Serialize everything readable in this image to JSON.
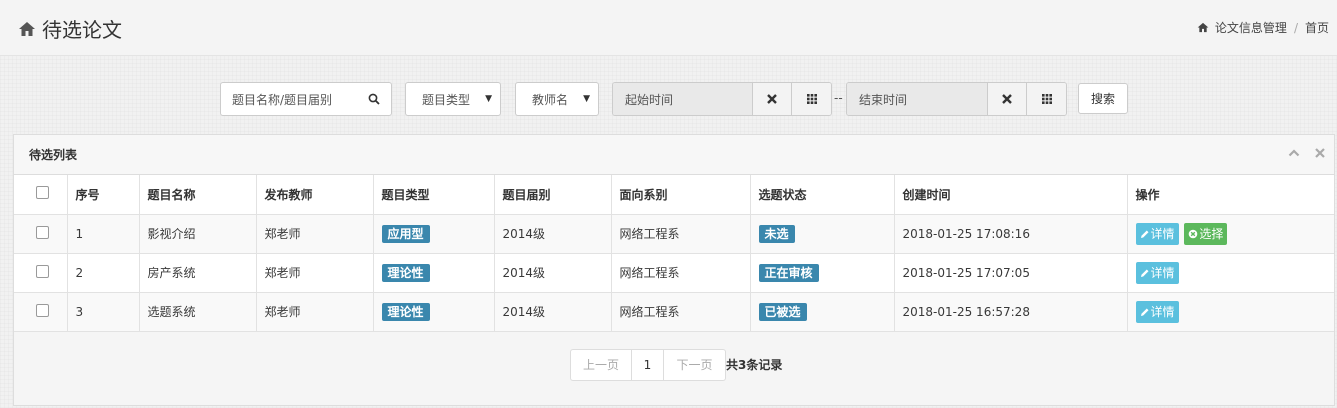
{
  "header": {
    "title": "待选论文",
    "icon": "home-icon"
  },
  "breadcrumb": {
    "items": [
      "论文信息管理",
      "首页"
    ],
    "separator": "/"
  },
  "search": {
    "placeholder": "题目名称/题目届别",
    "type_select": "题目类型",
    "teacher_select": "教师名",
    "start_placeholder": "起始时间",
    "end_placeholder": "结束时间",
    "range_dash": "--",
    "search_button": "搜索"
  },
  "panel": {
    "title": "待选列表",
    "columns": [
      "序号",
      "题目名称",
      "发布教师",
      "题目类型",
      "题目届别",
      "面向系别",
      "选题状态",
      "创建时间",
      "操作"
    ],
    "rows": [
      {
        "no": "1",
        "name": "影视介绍",
        "teacher": "郑老师",
        "type": "应用型",
        "grade": "2014级",
        "dept": "网络工程系",
        "status": "未选",
        "created": "2018-01-25 17:08:16",
        "actions": [
          "详情",
          "选择"
        ]
      },
      {
        "no": "2",
        "name": "房产系统",
        "teacher": "郑老师",
        "type": "理论性",
        "grade": "2014级",
        "dept": "网络工程系",
        "status": "正在审核",
        "created": "2018-01-25 17:07:05",
        "actions": [
          "详情"
        ]
      },
      {
        "no": "3",
        "name": "选题系统",
        "teacher": "郑老师",
        "type": "理论性",
        "grade": "2014级",
        "dept": "网络工程系",
        "status": "已被选",
        "created": "2018-01-25 16:57:28",
        "actions": [
          "详情"
        ]
      }
    ]
  },
  "pagination": {
    "prev": "上一页",
    "current": "1",
    "next": "下一页",
    "total": "共3条记录"
  },
  "colors": {
    "label_blue": "#3a87ad",
    "btn_info": "#5bc0de",
    "btn_success": "#5cb85c"
  }
}
